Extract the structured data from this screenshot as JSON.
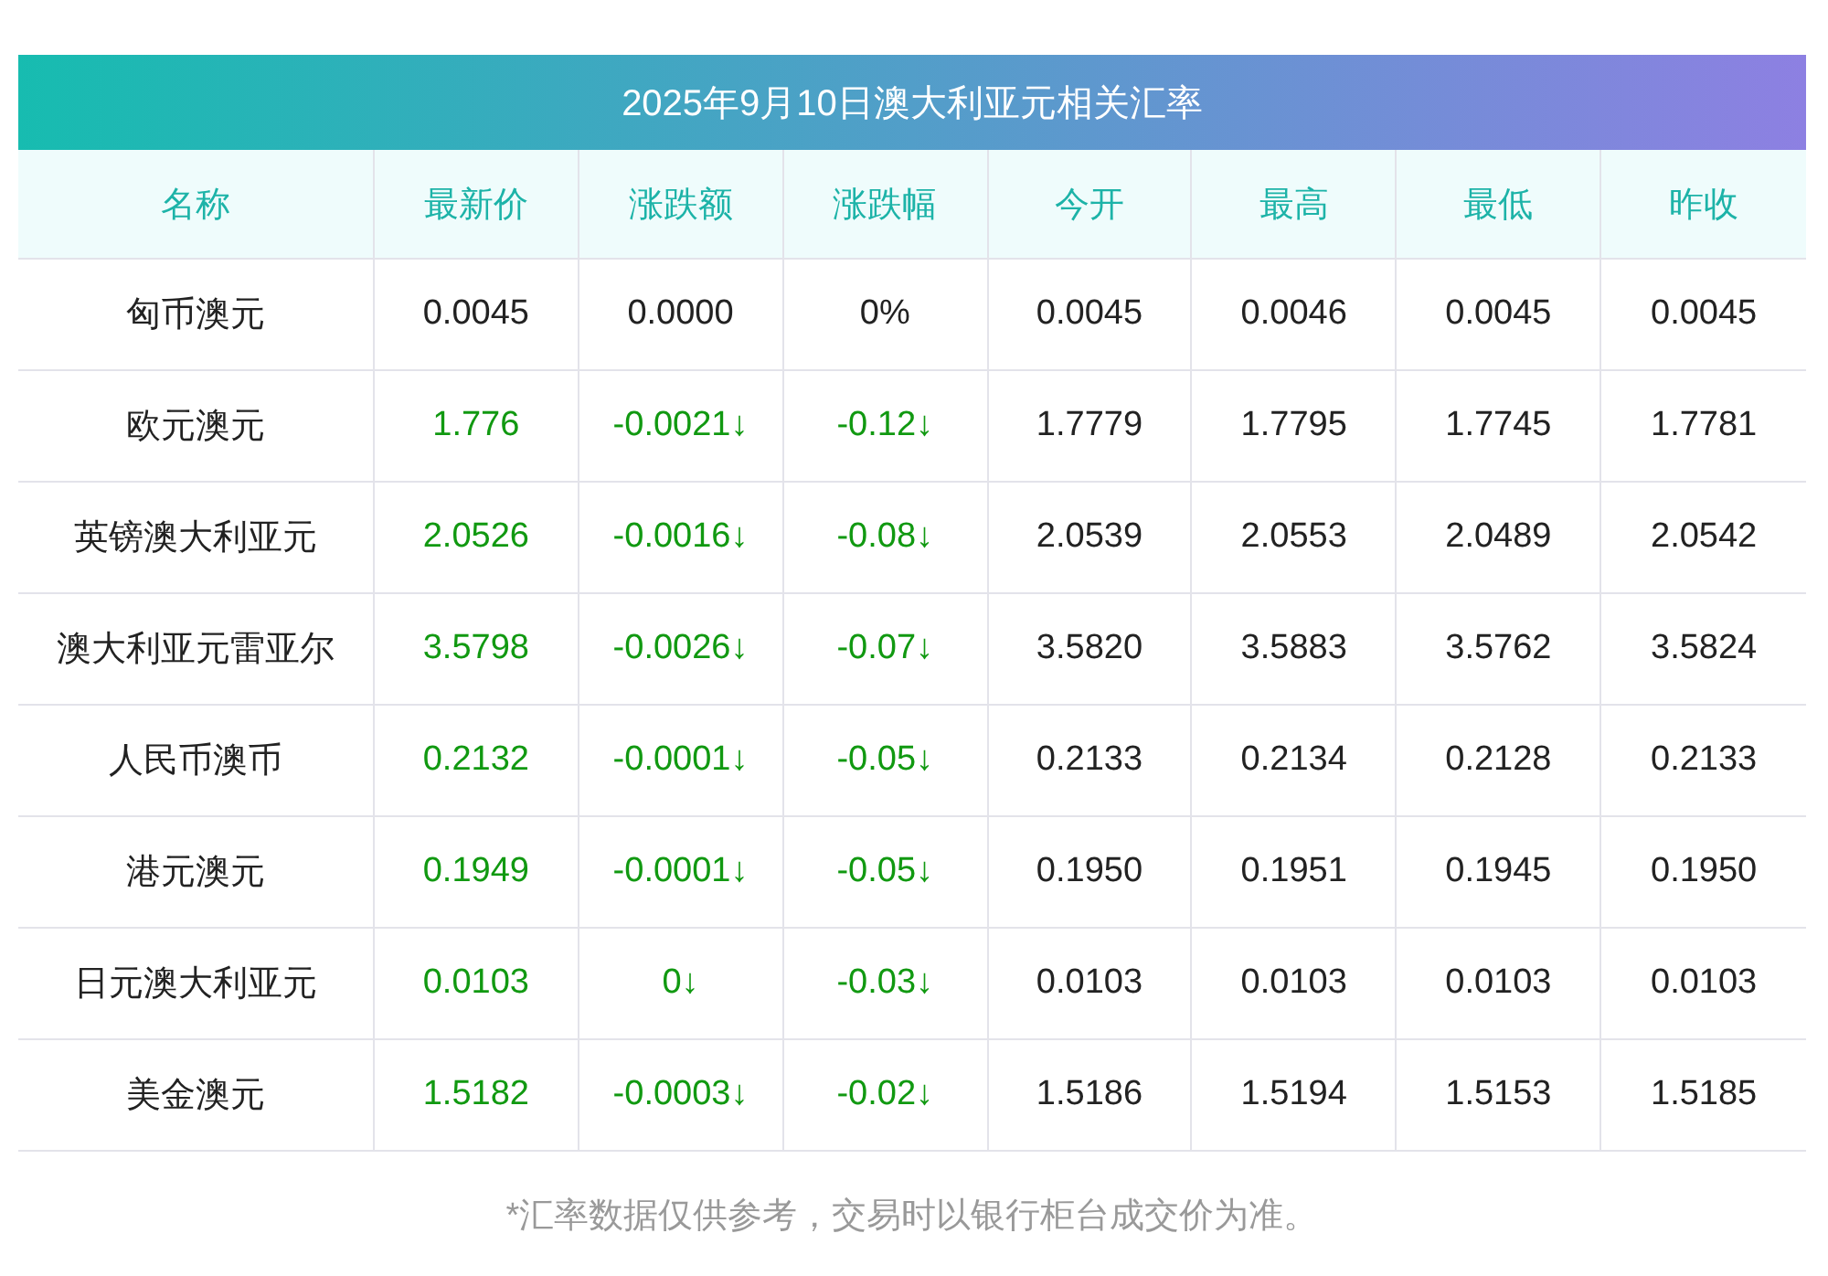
{
  "title": "2025年9月10日澳大利亚元相关汇率",
  "columns": [
    "名称",
    "最新价",
    "涨跌额",
    "涨跌幅",
    "今开",
    "最高",
    "最低",
    "昨收"
  ],
  "rows": [
    {
      "falling": false,
      "cells": [
        "匈币澳元",
        "0.0045",
        "0.0000",
        "0%",
        "0.0045",
        "0.0046",
        "0.0045",
        "0.0045"
      ]
    },
    {
      "falling": true,
      "cells": [
        "欧元澳元",
        "1.776",
        "-0.0021↓",
        "-0.12↓",
        "1.7779",
        "1.7795",
        "1.7745",
        "1.7781"
      ]
    },
    {
      "falling": true,
      "cells": [
        "英镑澳大利亚元",
        "2.0526",
        "-0.0016↓",
        "-0.08↓",
        "2.0539",
        "2.0553",
        "2.0489",
        "2.0542"
      ]
    },
    {
      "falling": true,
      "cells": [
        "澳大利亚元雷亚尔",
        "3.5798",
        "-0.0026↓",
        "-0.07↓",
        "3.5820",
        "3.5883",
        "3.5762",
        "3.5824"
      ]
    },
    {
      "falling": true,
      "cells": [
        "人民币澳币",
        "0.2132",
        "-0.0001↓",
        "-0.05↓",
        "0.2133",
        "0.2134",
        "0.2128",
        "0.2133"
      ]
    },
    {
      "falling": true,
      "cells": [
        "港元澳元",
        "0.1949",
        "-0.0001↓",
        "-0.05↓",
        "0.1950",
        "0.1951",
        "0.1945",
        "0.1950"
      ]
    },
    {
      "falling": true,
      "cells": [
        "日元澳大利亚元",
        "0.0103",
        "0↓",
        "-0.03↓",
        "0.0103",
        "0.0103",
        "0.0103",
        "0.0103"
      ]
    },
    {
      "falling": true,
      "cells": [
        "美金澳元",
        "1.5182",
        "-0.0003↓",
        "-0.02↓",
        "1.5186",
        "1.5194",
        "1.5153",
        "1.5185"
      ]
    }
  ],
  "note": "*汇率数据仅供参考，交易时以银行柜台成交价为准。"
}
